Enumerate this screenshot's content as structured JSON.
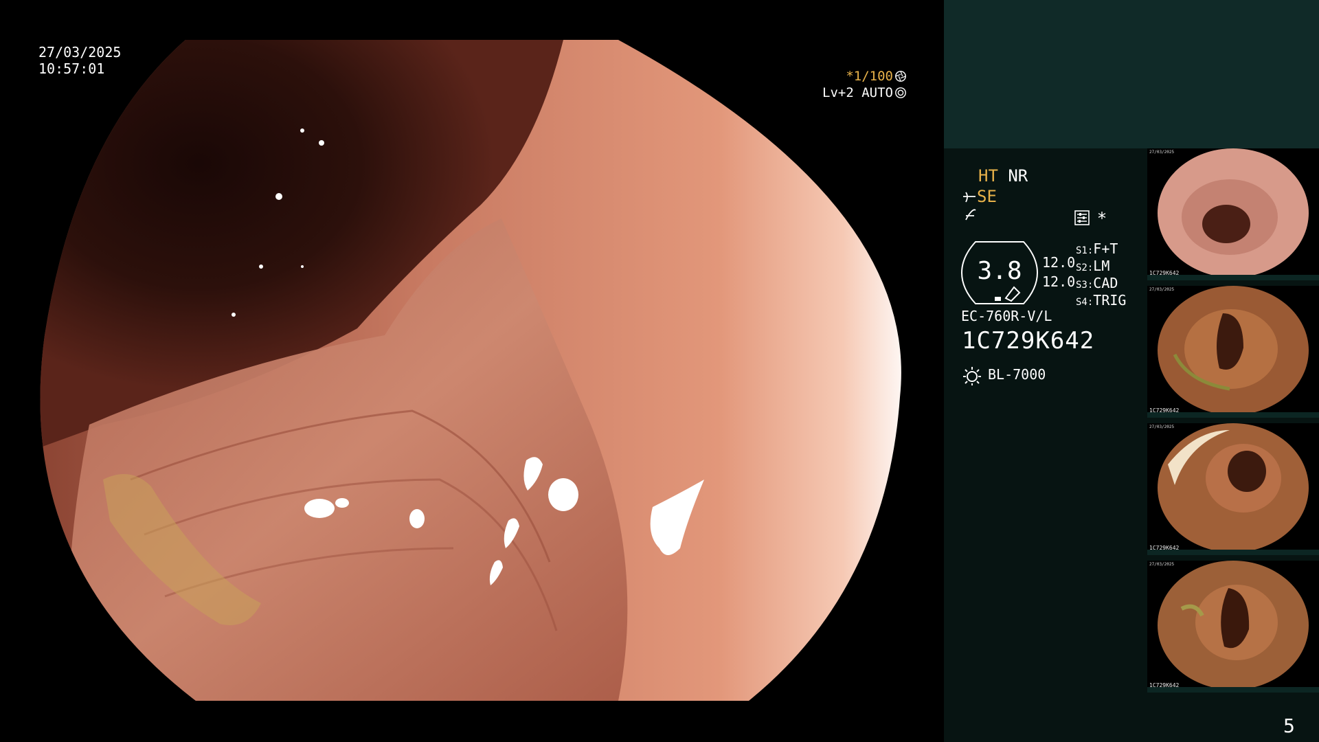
{
  "osd": {
    "date": "27/03/2025",
    "time": "10:57:01",
    "shutter": "*1/100",
    "level_mode": "Lv+2 AUTO",
    "shutter_icon": "aperture-icon",
    "level_icon": "auto-iris-icon"
  },
  "side": {
    "mode_ht": "HT",
    "mode_nr": "NR",
    "mode_se": "SE",
    "mode_se_icon": "enhancement-icon",
    "mode_extra_icon": "structure-icon",
    "settings_icon": "settings-icon",
    "star": "*",
    "dial_value": "3.8",
    "level_1": "12.0",
    "level_2": "12.0",
    "switches": [
      {
        "key": "S1",
        "value": "F+T"
      },
      {
        "key": "S2",
        "value": "LM"
      },
      {
        "key": "S3",
        "value": "CAD"
      },
      {
        "key": "S4",
        "value": "TRIG"
      }
    ],
    "scope_model": "EC-760R-V/L",
    "scope_serial": "1C729K642",
    "lamp_icon": "light-source-icon",
    "lamp_model": "BL-7000"
  },
  "thumbnails": [
    {
      "serial": "1C729K642",
      "info": "27/03/2025"
    },
    {
      "serial": "1C729K642",
      "info": "27/03/2025"
    },
    {
      "serial": "1C729K642",
      "info": "27/03/2025"
    },
    {
      "serial": "1C729K642",
      "info": "27/03/2025"
    }
  ],
  "page_number": "5",
  "colors": {
    "panel_top": "#102a28",
    "panel_side": "#071412",
    "accent_yellow": "#e8b24a",
    "mucosa": "#c8745c"
  }
}
